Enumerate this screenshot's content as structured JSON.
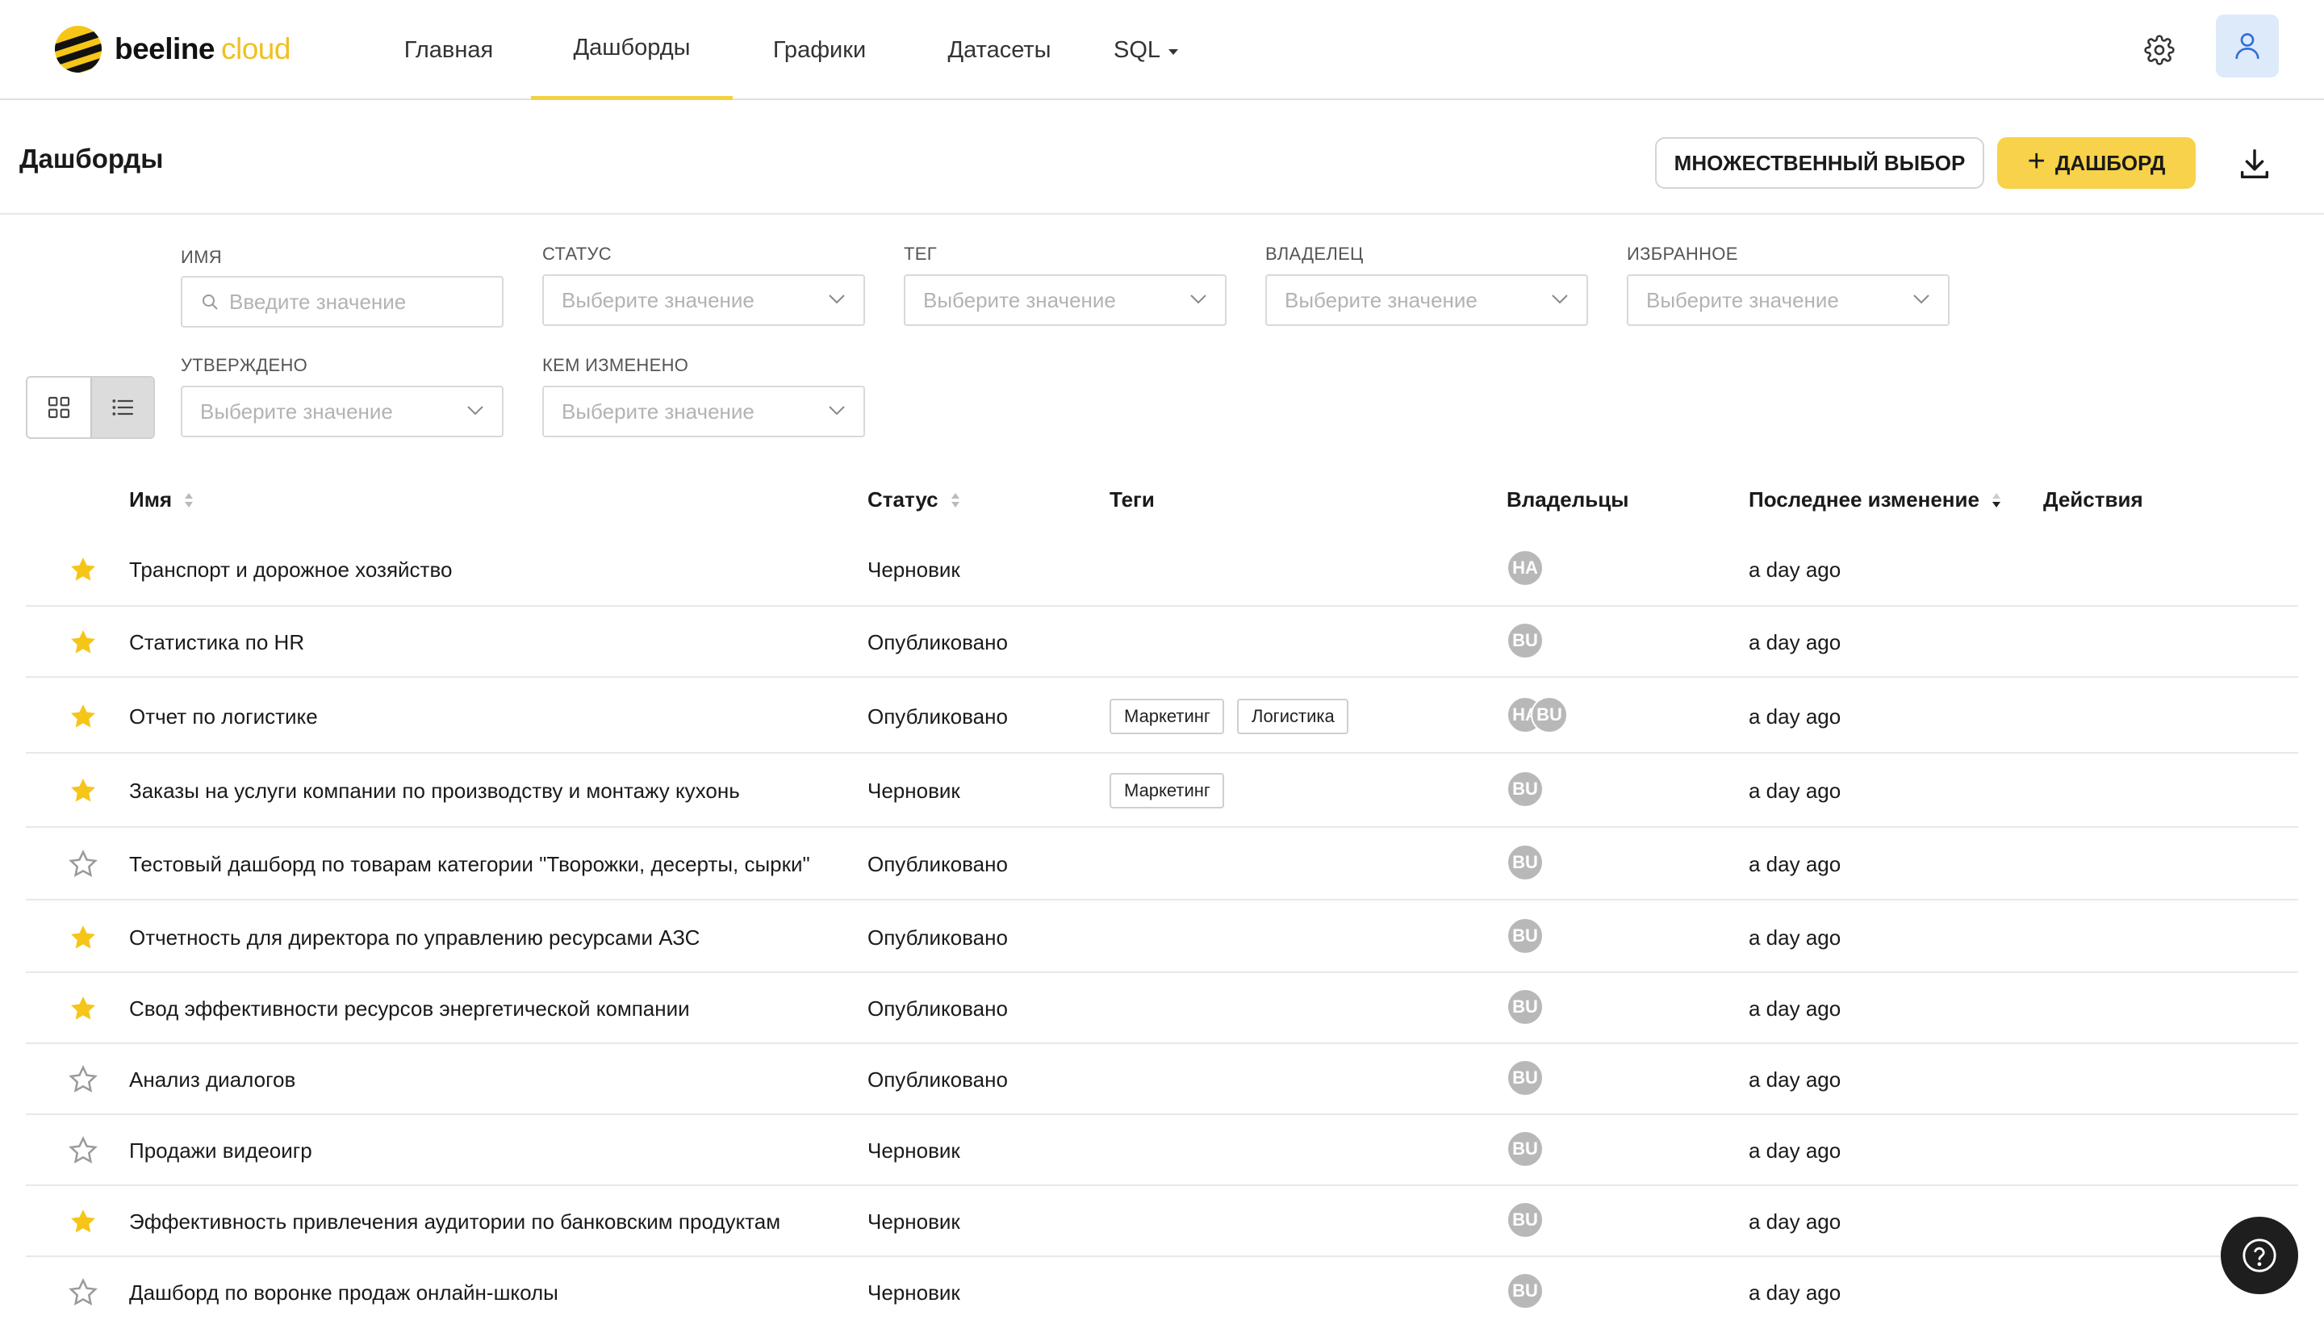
{
  "brand": {
    "word1": "beeline",
    "word2": "cloud",
    "accent": "#f5d142"
  },
  "nav": {
    "tabs": [
      {
        "label": "Главная",
        "active": false
      },
      {
        "label": "Дашборды",
        "active": true
      },
      {
        "label": "Графики",
        "active": false
      },
      {
        "label": "Датасеты",
        "active": false
      },
      {
        "label": "SQL",
        "active": false
      }
    ],
    "settings_icon": "gear-icon",
    "user_icon": "user-icon"
  },
  "header": {
    "title": "Дашборды",
    "multi_select_label": "МНОЖЕСТВЕННЫЙ ВЫБОР",
    "add_label": "ДАШБОРД",
    "download_icon": "download-icon"
  },
  "filters": {
    "name": {
      "label": "ИМЯ",
      "placeholder": "Введите значение"
    },
    "status": {
      "label": "СТАТУС",
      "placeholder": "Выберите значение"
    },
    "tag": {
      "label": "ТЕГ",
      "placeholder": "Выберите значение"
    },
    "owner": {
      "label": "ВЛАДЕЛЕЦ",
      "placeholder": "Выберите значение"
    },
    "favorite": {
      "label": "ИЗБРАННОЕ",
      "placeholder": "Выберите значение"
    },
    "approved": {
      "label": "УТВЕРЖДЕНО",
      "placeholder": "Выберите значение"
    },
    "changed_by": {
      "label": "КЕМ ИЗМЕНЕНО",
      "placeholder": "Выберите значение"
    }
  },
  "view_mode": "list",
  "table": {
    "columns": {
      "name": "Имя",
      "status": "Статус",
      "tags": "Теги",
      "owners": "Владельцы",
      "modified": "Последнее изменение",
      "actions": "Действия"
    },
    "rows": [
      {
        "favorite": true,
        "name": "Транспорт и дорожное хозяйство",
        "status": "Черновик",
        "tags": [],
        "owners": [
          "HA"
        ],
        "modified": "a day ago"
      },
      {
        "favorite": true,
        "name": "Статистика по HR",
        "status": "Опубликовано",
        "tags": [],
        "owners": [
          "BU"
        ],
        "modified": "a day ago"
      },
      {
        "favorite": true,
        "name": "Отчет по логистике",
        "status": "Опубликовано",
        "tags": [
          "Маркетинг",
          "Логистика"
        ],
        "owners": [
          "HA",
          "BU"
        ],
        "modified": "a day ago"
      },
      {
        "favorite": true,
        "name": "Заказы на услуги компании по производству и монтажу кухонь",
        "status": "Черновик",
        "tags": [
          "Маркетинг"
        ],
        "owners": [
          "BU"
        ],
        "modified": "a day ago"
      },
      {
        "favorite": false,
        "name": "Тестовый дашборд по товарам категории \"Творожки, десерты, сырки\"",
        "status": "Опубликовано",
        "tags": [],
        "owners": [
          "BU"
        ],
        "modified": "a day ago"
      },
      {
        "favorite": true,
        "name": "Отчетность для директора по управлению ресурсами АЗС",
        "status": "Опубликовано",
        "tags": [],
        "owners": [
          "BU"
        ],
        "modified": "a day ago"
      },
      {
        "favorite": true,
        "name": "Свод эффективности ресурсов энергетической компании",
        "status": "Опубликовано",
        "tags": [],
        "owners": [
          "BU"
        ],
        "modified": "a day ago"
      },
      {
        "favorite": false,
        "name": "Анализ диалогов",
        "status": "Опубликовано",
        "tags": [],
        "owners": [
          "BU"
        ],
        "modified": "a day ago"
      },
      {
        "favorite": false,
        "name": "Продажи видеоигр",
        "status": "Черновик",
        "tags": [],
        "owners": [
          "BU"
        ],
        "modified": "a day ago"
      },
      {
        "favorite": true,
        "name": "Эффективность привлечения аудитории по банковским продуктам",
        "status": "Черновик",
        "tags": [],
        "owners": [
          "BU"
        ],
        "modified": "a day ago"
      },
      {
        "favorite": false,
        "name": "Дашборд по воронке продаж онлайн-школы",
        "status": "Черновик",
        "tags": [],
        "owners": [
          "BU"
        ],
        "modified": "a day ago"
      }
    ]
  },
  "colors": {
    "star_on": "#f5c518",
    "star_off": "#9a9a9a",
    "owner_avatar": "#b8b8b8",
    "primary_button": "#f7d24a"
  },
  "help_icon": "help-icon"
}
